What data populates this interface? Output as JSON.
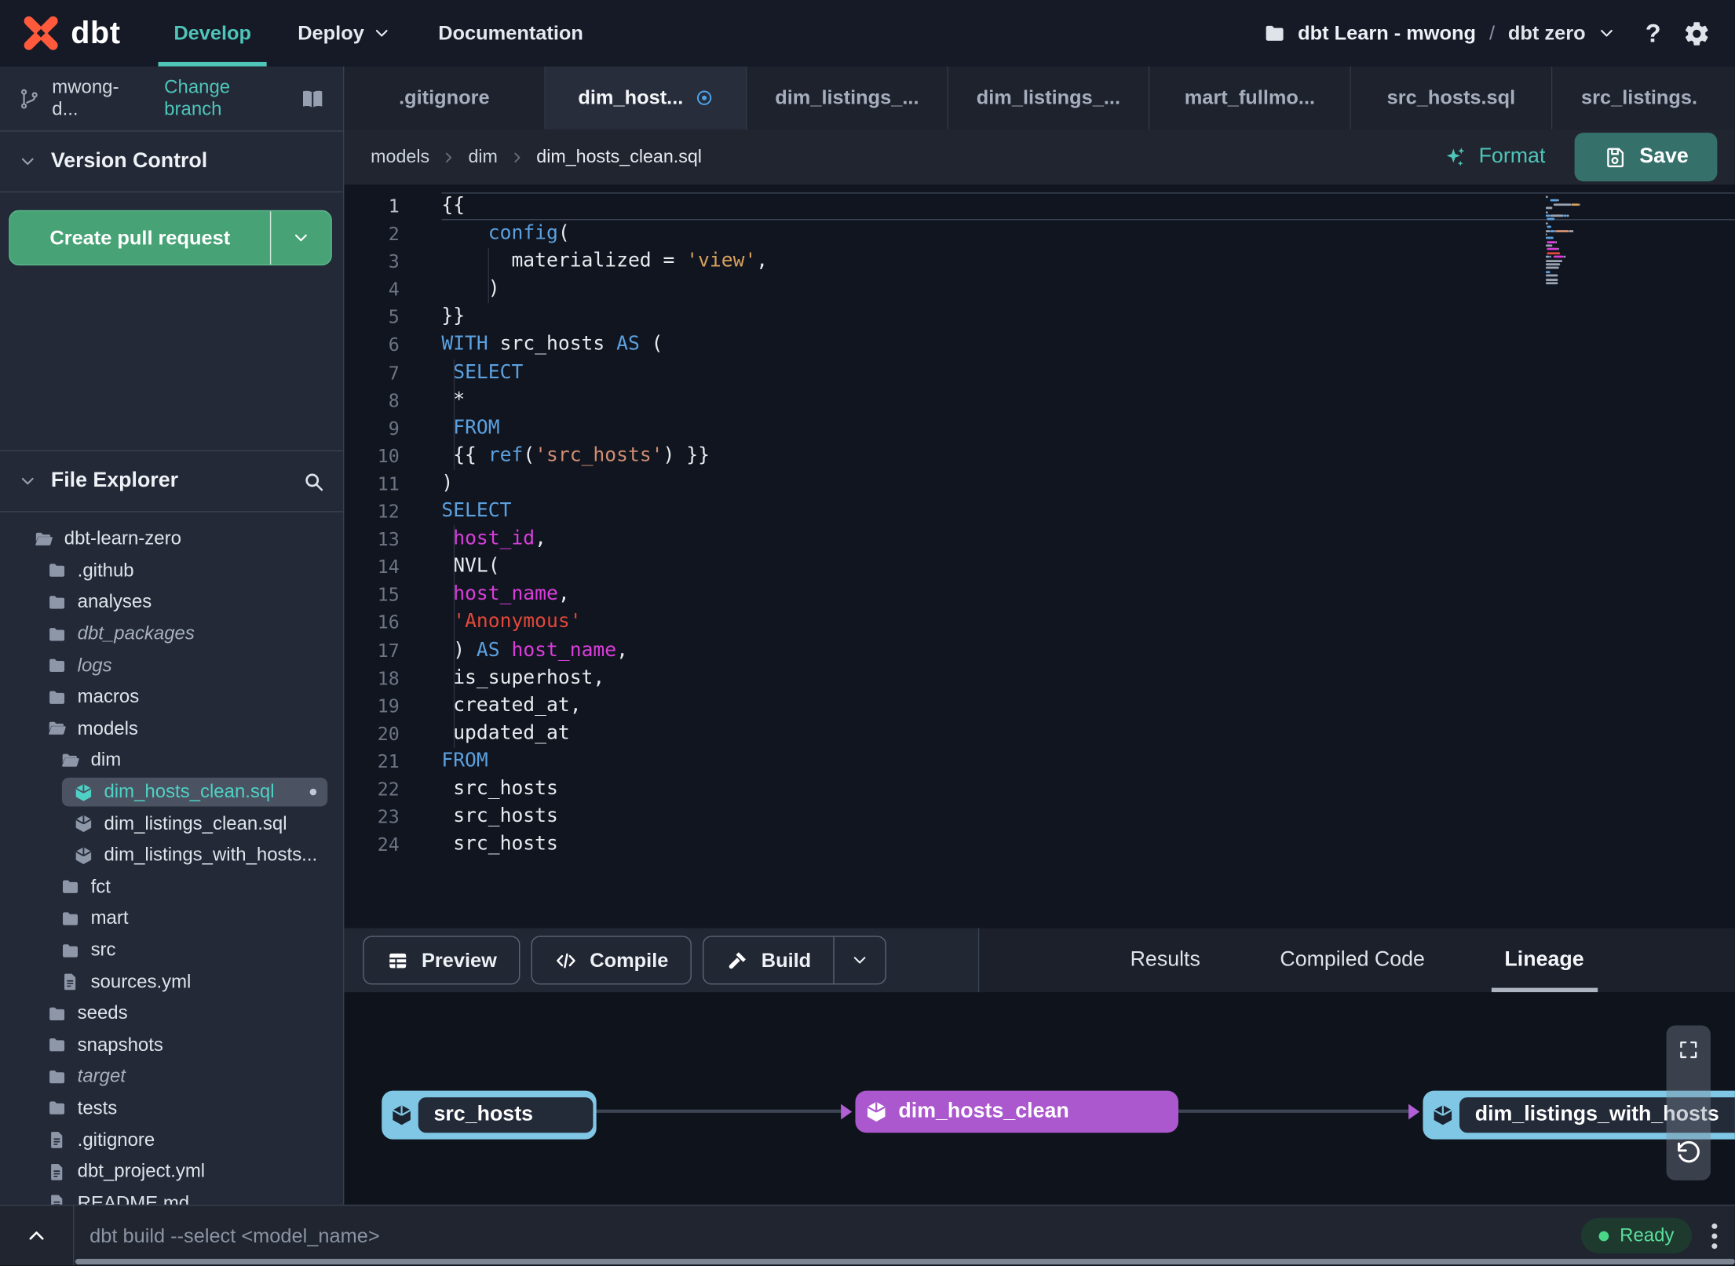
{
  "navbar": {
    "brand": "dbt",
    "nav": [
      {
        "label": "Develop",
        "active": true
      },
      {
        "label": "Deploy",
        "chevron": true
      },
      {
        "label": "Documentation"
      }
    ],
    "project_account": "dbt Learn - mwong",
    "project_separator": "/",
    "project_name": "dbt zero",
    "help_label": "?"
  },
  "sidebar": {
    "branch_name": "mwong-d...",
    "change_branch": "Change branch",
    "version_control_title": "Version Control",
    "create_pr_label": "Create pull request",
    "file_explorer_title": "File Explorer",
    "tree": [
      {
        "label": "dbt-learn-zero",
        "type": "folder-open",
        "indent": 0
      },
      {
        "label": ".github",
        "type": "folder",
        "indent": 1
      },
      {
        "label": "analyses",
        "type": "folder",
        "indent": 1
      },
      {
        "label": "dbt_packages",
        "type": "folder",
        "indent": 1,
        "italic": true
      },
      {
        "label": "logs",
        "type": "folder",
        "indent": 1,
        "italic": true
      },
      {
        "label": "macros",
        "type": "folder",
        "indent": 1
      },
      {
        "label": "models",
        "type": "folder-open",
        "indent": 1
      },
      {
        "label": "dim",
        "type": "folder-open",
        "indent": 2
      },
      {
        "label": "dim_hosts_clean.sql",
        "type": "model",
        "indent": 3,
        "selected": true,
        "modified": true
      },
      {
        "label": "dim_listings_clean.sql",
        "type": "model",
        "indent": 3
      },
      {
        "label": "dim_listings_with_hosts...",
        "type": "model",
        "indent": 3
      },
      {
        "label": "fct",
        "type": "folder",
        "indent": 2
      },
      {
        "label": "mart",
        "type": "folder",
        "indent": 2
      },
      {
        "label": "src",
        "type": "folder",
        "indent": 2
      },
      {
        "label": "sources.yml",
        "type": "file",
        "indent": 2
      },
      {
        "label": "seeds",
        "type": "folder",
        "indent": 1
      },
      {
        "label": "snapshots",
        "type": "folder",
        "indent": 1
      },
      {
        "label": "target",
        "type": "folder",
        "indent": 1,
        "italic": true
      },
      {
        "label": "tests",
        "type": "folder",
        "indent": 1
      },
      {
        "label": ".gitignore",
        "type": "file",
        "indent": 1
      },
      {
        "label": "dbt_project.yml",
        "type": "file",
        "indent": 1
      },
      {
        "label": "README.md",
        "type": "file",
        "indent": 1
      }
    ]
  },
  "tabs": [
    {
      "label": ".gitignore"
    },
    {
      "label": "dim_host...",
      "active": true,
      "modified": true
    },
    {
      "label": "dim_listings_..."
    },
    {
      "label": "dim_listings_..."
    },
    {
      "label": "mart_fullmo..."
    },
    {
      "label": "src_hosts.sql"
    },
    {
      "label": "src_listings.",
      "clipped": true
    }
  ],
  "new_tab_label": "+",
  "breadcrumb": [
    "models",
    "dim",
    "dim_hosts_clean.sql"
  ],
  "editor_actions": {
    "format": "Format",
    "save": "Save"
  },
  "editor": {
    "lines": [
      {
        "tokens": [
          [
            "{{",
            "p"
          ]
        ],
        "current": true
      },
      {
        "tokens": [
          [
            "    ",
            "p"
          ],
          [
            "config",
            "k"
          ],
          [
            "(",
            "p"
          ]
        ]
      },
      {
        "tokens": [
          [
            "      ",
            "p"
          ],
          [
            "materialized = ",
            "p"
          ],
          [
            "'view'",
            "s1"
          ],
          [
            ",",
            "p"
          ]
        ],
        "guides": [
          4
        ]
      },
      {
        "tokens": [
          [
            "    )",
            "p"
          ]
        ],
        "guides": [
          4
        ]
      },
      {
        "tokens": [
          [
            "}}",
            "p"
          ]
        ]
      },
      {
        "tokens": [
          [
            "WITH",
            "k"
          ],
          [
            " src_hosts ",
            "p"
          ],
          [
            "AS",
            "k"
          ],
          [
            " (",
            "p"
          ]
        ]
      },
      {
        "tokens": [
          [
            " ",
            "p"
          ],
          [
            "SELECT",
            "k"
          ]
        ],
        "guides": [
          1
        ]
      },
      {
        "tokens": [
          [
            " *",
            "p"
          ]
        ],
        "guides": [
          1
        ]
      },
      {
        "tokens": [
          [
            " ",
            "p"
          ],
          [
            "FROM",
            "k"
          ]
        ],
        "guides": [
          1
        ]
      },
      {
        "tokens": [
          [
            " {{ ",
            "p"
          ],
          [
            "ref",
            "k"
          ],
          [
            "(",
            "p"
          ],
          [
            "'src_hosts'",
            "s2"
          ],
          [
            ") }}",
            "p"
          ]
        ],
        "guides": [
          1
        ]
      },
      {
        "tokens": [
          [
            ")",
            "p"
          ]
        ]
      },
      {
        "tokens": [
          [
            "SELECT",
            "k"
          ]
        ]
      },
      {
        "tokens": [
          [
            " ",
            "p"
          ],
          [
            "host_id",
            "i"
          ],
          [
            ",",
            "p"
          ]
        ],
        "guides": [
          1
        ]
      },
      {
        "tokens": [
          [
            " NVL(",
            "p"
          ]
        ],
        "guides": [
          1
        ]
      },
      {
        "tokens": [
          [
            " ",
            "p"
          ],
          [
            "host_name",
            "i"
          ],
          [
            ",",
            "p"
          ]
        ],
        "guides": [
          1
        ]
      },
      {
        "tokens": [
          [
            " ",
            "p"
          ],
          [
            "'Anonymous'",
            "s3"
          ]
        ],
        "guides": [
          1
        ]
      },
      {
        "tokens": [
          [
            " ) ",
            "p"
          ],
          [
            "AS",
            "k"
          ],
          [
            " ",
            "p"
          ],
          [
            "host_name",
            "i"
          ],
          [
            ",",
            "p"
          ]
        ],
        "guides": [
          1
        ]
      },
      {
        "tokens": [
          [
            " is_superhost,",
            "p"
          ]
        ],
        "guides": [
          1
        ]
      },
      {
        "tokens": [
          [
            " created_at,",
            "p"
          ]
        ],
        "guides": [
          1
        ]
      },
      {
        "tokens": [
          [
            " updated_at",
            "p"
          ]
        ],
        "guides": [
          1
        ]
      },
      {
        "tokens": [
          [
            "FROM",
            "k"
          ]
        ]
      },
      {
        "tokens": [
          [
            " src_hosts",
            "p"
          ]
        ]
      },
      {
        "tokens": [
          [
            " src_hosts",
            "p"
          ]
        ]
      },
      {
        "tokens": [
          [
            " src_hosts",
            "p"
          ]
        ]
      }
    ]
  },
  "bottom_panel": {
    "buttons": [
      {
        "label": "Preview",
        "icon": "grid"
      },
      {
        "label": "Compile",
        "icon": "code"
      },
      {
        "label": "Build",
        "icon": "hammer",
        "split": true
      }
    ],
    "tabs": [
      {
        "label": "Results"
      },
      {
        "label": "Compiled Code"
      },
      {
        "label": "Lineage",
        "active": true
      }
    ]
  },
  "lineage": {
    "nodes": [
      {
        "label": "src_hosts",
        "style": "cyan"
      },
      {
        "label": "dim_hosts_clean",
        "style": "purple"
      },
      {
        "label": "dim_listings_with_hosts",
        "style": "cyan"
      }
    ]
  },
  "command_bar": {
    "placeholder": "dbt build --select <model_name>",
    "status": "Ready"
  },
  "colors": {
    "accent_teal": "#4fc4b8",
    "brand_orange": "#ff5a3c",
    "green_button": "#47a376",
    "save_teal": "#35706a",
    "node_cyan": "#7fc7e5",
    "node_purple": "#ab57ce",
    "status_green": "#5adf9c",
    "tab_modified_blue": "#4da3e8",
    "syntax_keyword": "#5ba1e0",
    "syntax_identifier": "#da3ddc",
    "syntax_string_red": "#e2483a"
  }
}
